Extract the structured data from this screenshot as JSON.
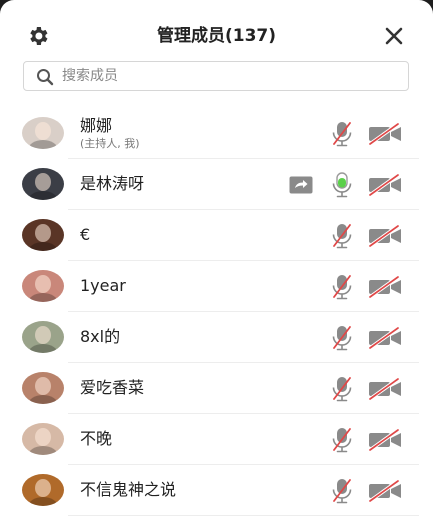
{
  "header": {
    "title": "管理成员(137)",
    "settings_icon": "gear-icon",
    "close_icon": "close-icon"
  },
  "search": {
    "placeholder": "搜索成员",
    "icon": "search-icon"
  },
  "colors": {
    "muted_red": "#e04848",
    "icon_gray": "#8a8a8a",
    "mic_active_green": "#5bd04a",
    "separator": "#ededed"
  },
  "members": [
    {
      "name": "娜娜",
      "role": "(主持人, 我)",
      "mic": "muted",
      "camera": "off",
      "sharing": false,
      "avatar_color": "#d9cfc8"
    },
    {
      "name": "是林涛呀",
      "mic": "active",
      "camera": "off",
      "sharing": true,
      "avatar_color": "#3b3e46"
    },
    {
      "name": "€",
      "mic": "muted",
      "camera": "off",
      "sharing": false,
      "avatar_color": "#5a3526"
    },
    {
      "name": "1year",
      "mic": "muted",
      "camera": "off",
      "sharing": false,
      "avatar_color": "#c9877a"
    },
    {
      "name": "8xl的",
      "mic": "muted",
      "camera": "off",
      "sharing": false,
      "avatar_color": "#9aa38a"
    },
    {
      "name": "爱吃香菜",
      "mic": "muted",
      "camera": "off",
      "sharing": false,
      "avatar_color": "#b8826a"
    },
    {
      "name": "不晚",
      "mic": "muted",
      "camera": "off",
      "sharing": false,
      "avatar_color": "#d6b9a6"
    },
    {
      "name": "不信鬼神之说",
      "mic": "muted",
      "camera": "off",
      "sharing": false,
      "avatar_color": "#b06a2a"
    }
  ]
}
